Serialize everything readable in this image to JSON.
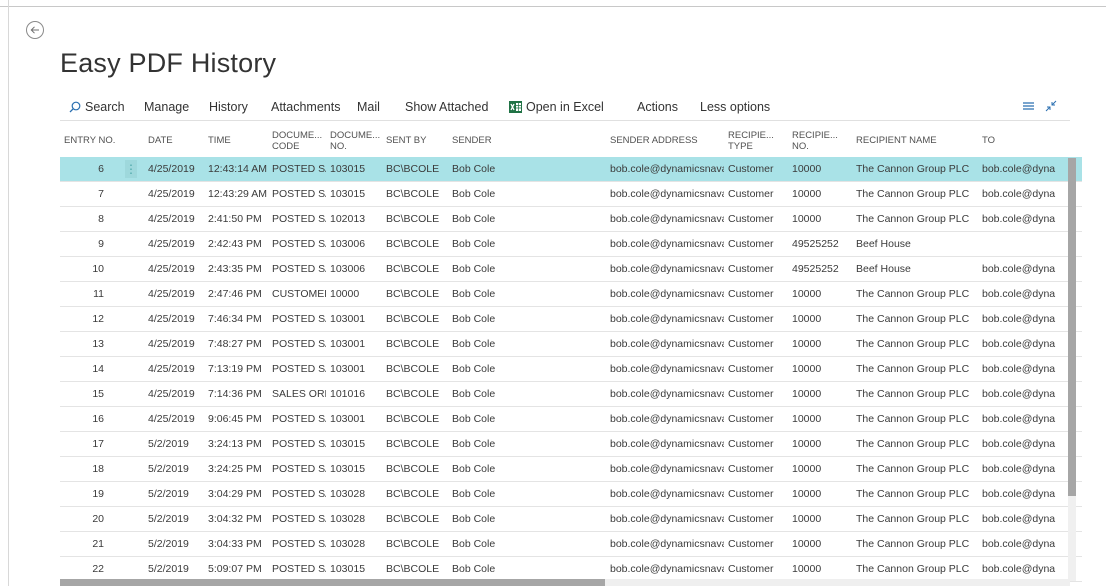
{
  "page": {
    "title": "Easy PDF History"
  },
  "icons": {
    "back": "back-arrow-icon",
    "search": "search-icon",
    "excel": "excel-icon",
    "list_view": "list-view-icon",
    "collapse": "collapse-icon"
  },
  "colors": {
    "selected_row": "#a9e2e7",
    "excel_green": "#217346",
    "scroll_thumb": "#a6a6a6"
  },
  "actionbar": {
    "search": "Search",
    "manage": "Manage",
    "history": "History",
    "attachments": "Attachments",
    "mail": "Mail",
    "show_attached": "Show Attached",
    "open_in_excel": "Open in Excel",
    "actions": "Actions",
    "less_options": "Less options"
  },
  "table": {
    "headers": {
      "entry_no": "ENTRY NO.",
      "date": "DATE",
      "time": "TIME",
      "document_code_1": "DOCUME...",
      "document_code_2": "CODE",
      "document_no_1": "DOCUME...",
      "document_no_2": "NO.",
      "sent_by": "SENT BY",
      "sender": "SENDER",
      "sender_address": "SENDER ADDRESS",
      "recipient_type_1": "RECIPIE...",
      "recipient_type_2": "TYPE",
      "recipient_no_1": "RECIPIE...",
      "recipient_no_2": "NO.",
      "recipient_name": "RECIPIENT NAME",
      "to": "TO"
    },
    "selected_index": 0,
    "rows": [
      {
        "entry_no": "6",
        "date": "4/25/2019",
        "time": "12:43:14 AM",
        "doc_code": "POSTED SA...",
        "doc_no": "103015",
        "sent_by": "BC\\BCOLE",
        "sender": "Bob Cole",
        "sender_address": "bob.cole@dynamicsnavad...",
        "recipient_type": "Customer",
        "recipient_no": "10000",
        "recipient_name": "The Cannon Group PLC",
        "to": "bob.cole@dyna"
      },
      {
        "entry_no": "7",
        "date": "4/25/2019",
        "time": "12:43:29 AM",
        "doc_code": "POSTED SA...",
        "doc_no": "103015",
        "sent_by": "BC\\BCOLE",
        "sender": "Bob Cole",
        "sender_address": "bob.cole@dynamicsnavad...",
        "recipient_type": "Customer",
        "recipient_no": "10000",
        "recipient_name": "The Cannon Group PLC",
        "to": "bob.cole@dyna"
      },
      {
        "entry_no": "8",
        "date": "4/25/2019",
        "time": "2:41:50 PM",
        "doc_code": "POSTED SA...",
        "doc_no": "102013",
        "sent_by": "BC\\BCOLE",
        "sender": "Bob Cole",
        "sender_address": "bob.cole@dynamicsnavad...",
        "recipient_type": "Customer",
        "recipient_no": "10000",
        "recipient_name": "The Cannon Group PLC",
        "to": "bob.cole@dyna"
      },
      {
        "entry_no": "9",
        "date": "4/25/2019",
        "time": "2:42:43 PM",
        "doc_code": "POSTED SA...",
        "doc_no": "103006",
        "sent_by": "BC\\BCOLE",
        "sender": "Bob Cole",
        "sender_address": "bob.cole@dynamicsnavad...",
        "recipient_type": "Customer",
        "recipient_no": "49525252",
        "recipient_name": "Beef House",
        "to": ""
      },
      {
        "entry_no": "10",
        "date": "4/25/2019",
        "time": "2:43:35 PM",
        "doc_code": "POSTED SA...",
        "doc_no": "103006",
        "sent_by": "BC\\BCOLE",
        "sender": "Bob Cole",
        "sender_address": "bob.cole@dynamicsnavad...",
        "recipient_type": "Customer",
        "recipient_no": "49525252",
        "recipient_name": "Beef House",
        "to": "bob.cole@dyna"
      },
      {
        "entry_no": "11",
        "date": "4/25/2019",
        "time": "2:47:46 PM",
        "doc_code": "CUSTOMER...",
        "doc_no": "10000",
        "sent_by": "BC\\BCOLE",
        "sender": "Bob Cole",
        "sender_address": "bob.cole@dynamicsnavad...",
        "recipient_type": "Customer",
        "recipient_no": "10000",
        "recipient_name": "The Cannon Group PLC",
        "to": "bob.cole@dyna"
      },
      {
        "entry_no": "12",
        "date": "4/25/2019",
        "time": "7:46:34 PM",
        "doc_code": "POSTED SA...",
        "doc_no": "103001",
        "sent_by": "BC\\BCOLE",
        "sender": "Bob Cole",
        "sender_address": "bob.cole@dynamicsnavad...",
        "recipient_type": "Customer",
        "recipient_no": "10000",
        "recipient_name": "The Cannon Group PLC",
        "to": "bob.cole@dyna"
      },
      {
        "entry_no": "13",
        "date": "4/25/2019",
        "time": "7:48:27 PM",
        "doc_code": "POSTED SA...",
        "doc_no": "103001",
        "sent_by": "BC\\BCOLE",
        "sender": "Bob Cole",
        "sender_address": "bob.cole@dynamicsnavad...",
        "recipient_type": "Customer",
        "recipient_no": "10000",
        "recipient_name": "The Cannon Group PLC",
        "to": "bob.cole@dyna"
      },
      {
        "entry_no": "14",
        "date": "4/25/2019",
        "time": "7:13:19 PM",
        "doc_code": "POSTED SA...",
        "doc_no": "103001",
        "sent_by": "BC\\BCOLE",
        "sender": "Bob Cole",
        "sender_address": "bob.cole@dynamicsnavad...",
        "recipient_type": "Customer",
        "recipient_no": "10000",
        "recipient_name": "The Cannon Group PLC",
        "to": "bob.cole@dyna"
      },
      {
        "entry_no": "15",
        "date": "4/25/2019",
        "time": "7:14:36 PM",
        "doc_code": "SALES ORD...",
        "doc_no": "101016",
        "sent_by": "BC\\BCOLE",
        "sender": "Bob Cole",
        "sender_address": "bob.cole@dynamicsnavad...",
        "recipient_type": "Customer",
        "recipient_no": "10000",
        "recipient_name": "The Cannon Group PLC",
        "to": "bob.cole@dyna"
      },
      {
        "entry_no": "16",
        "date": "4/25/2019",
        "time": "9:06:45 PM",
        "doc_code": "POSTED SA...",
        "doc_no": "103001",
        "sent_by": "BC\\BCOLE",
        "sender": "Bob Cole",
        "sender_address": "bob.cole@dynamicsnavad...",
        "recipient_type": "Customer",
        "recipient_no": "10000",
        "recipient_name": "The Cannon Group PLC",
        "to": "bob.cole@dyna"
      },
      {
        "entry_no": "17",
        "date": "5/2/2019",
        "time": "3:24:13 PM",
        "doc_code": "POSTED SA...",
        "doc_no": "103015",
        "sent_by": "BC\\BCOLE",
        "sender": "Bob Cole",
        "sender_address": "bob.cole@dynamicsnavad...",
        "recipient_type": "Customer",
        "recipient_no": "10000",
        "recipient_name": "The Cannon Group PLC",
        "to": "bob.cole@dyna"
      },
      {
        "entry_no": "18",
        "date": "5/2/2019",
        "time": "3:24:25 PM",
        "doc_code": "POSTED SA...",
        "doc_no": "103015",
        "sent_by": "BC\\BCOLE",
        "sender": "Bob Cole",
        "sender_address": "bob.cole@dynamicsnavad...",
        "recipient_type": "Customer",
        "recipient_no": "10000",
        "recipient_name": "The Cannon Group PLC",
        "to": "bob.cole@dyna"
      },
      {
        "entry_no": "19",
        "date": "5/2/2019",
        "time": "3:04:29 PM",
        "doc_code": "POSTED SA...",
        "doc_no": "103028",
        "sent_by": "BC\\BCOLE",
        "sender": "Bob Cole",
        "sender_address": "bob.cole@dynamicsnavad...",
        "recipient_type": "Customer",
        "recipient_no": "10000",
        "recipient_name": "The Cannon Group PLC",
        "to": "bob.cole@dyna"
      },
      {
        "entry_no": "20",
        "date": "5/2/2019",
        "time": "3:04:32 PM",
        "doc_code": "POSTED SA...",
        "doc_no": "103028",
        "sent_by": "BC\\BCOLE",
        "sender": "Bob Cole",
        "sender_address": "bob.cole@dynamicsnavad...",
        "recipient_type": "Customer",
        "recipient_no": "10000",
        "recipient_name": "The Cannon Group PLC",
        "to": "bob.cole@dyna"
      },
      {
        "entry_no": "21",
        "date": "5/2/2019",
        "time": "3:04:33 PM",
        "doc_code": "POSTED SA...",
        "doc_no": "103028",
        "sent_by": "BC\\BCOLE",
        "sender": "Bob Cole",
        "sender_address": "bob.cole@dynamicsnavad...",
        "recipient_type": "Customer",
        "recipient_no": "10000",
        "recipient_name": "The Cannon Group PLC",
        "to": "bob.cole@dyna"
      },
      {
        "entry_no": "22",
        "date": "5/2/2019",
        "time": "5:09:07 PM",
        "doc_code": "POSTED SA...",
        "doc_no": "103015",
        "sent_by": "BC\\BCOLE",
        "sender": "Bob Cole",
        "sender_address": "bob.cole@dynamicsnavad...",
        "recipient_type": "Customer",
        "recipient_no": "10000",
        "recipient_name": "The Cannon Group PLC",
        "to": "bob.cole@dyna"
      }
    ]
  }
}
